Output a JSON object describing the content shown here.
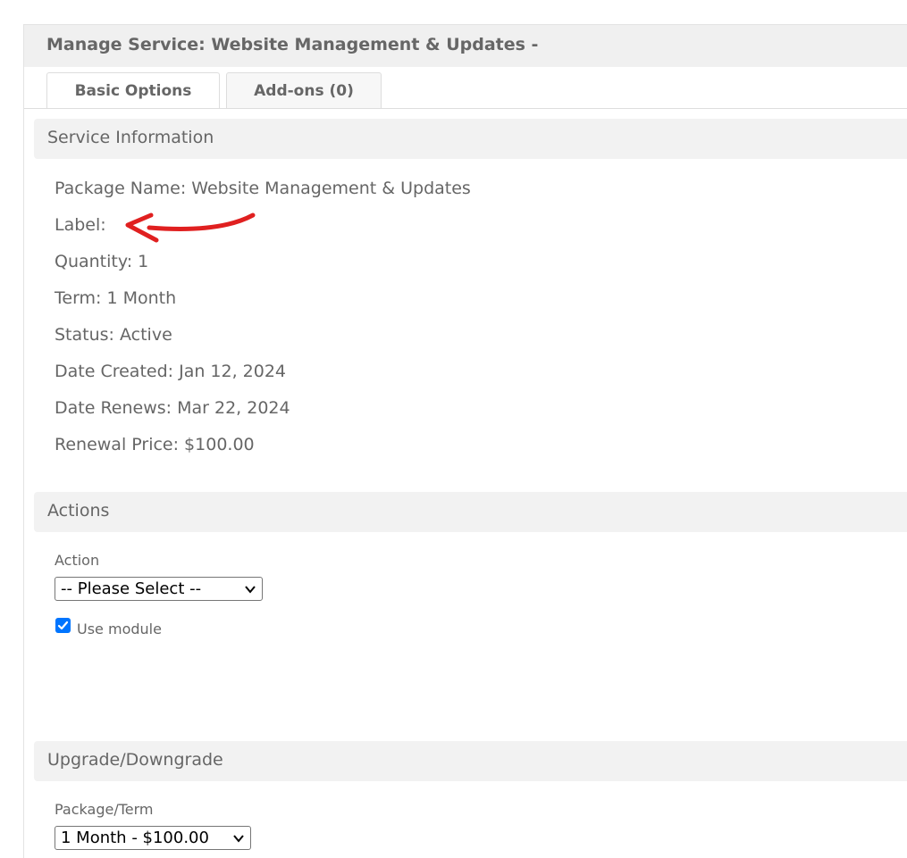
{
  "header": {
    "title": "Manage Service: Website Management & Updates -"
  },
  "tabs": [
    {
      "label": "Basic Options",
      "active": true
    },
    {
      "label": "Add-ons (0)",
      "active": false
    }
  ],
  "service_info": {
    "title": "Service Information",
    "lines": [
      "Package Name: Website Management & Updates",
      "Label:",
      "Quantity: 1",
      "Term: 1 Month",
      "Status: Active",
      "Date Created: Jan 12, 2024",
      "Date Renews: Mar 22, 2024",
      "Renewal Price: $100.00"
    ]
  },
  "actions": {
    "title": "Actions",
    "action_label": "Action",
    "action_selected": "-- Please Select --",
    "use_module_label": "Use module",
    "use_module_checked": true
  },
  "upgrade": {
    "title": "Upgrade/Downgrade",
    "package_term_label": "Package/Term",
    "package_term_selected": "1 Month - $100.00"
  },
  "colors": {
    "annotation_arrow": "#e02020",
    "checkbox_accent": "#0075ff"
  },
  "icons": {
    "annotation": "red-arrow-icon",
    "select_chevron": "chevron-down-icon",
    "checkbox": "checkmark-icon"
  }
}
